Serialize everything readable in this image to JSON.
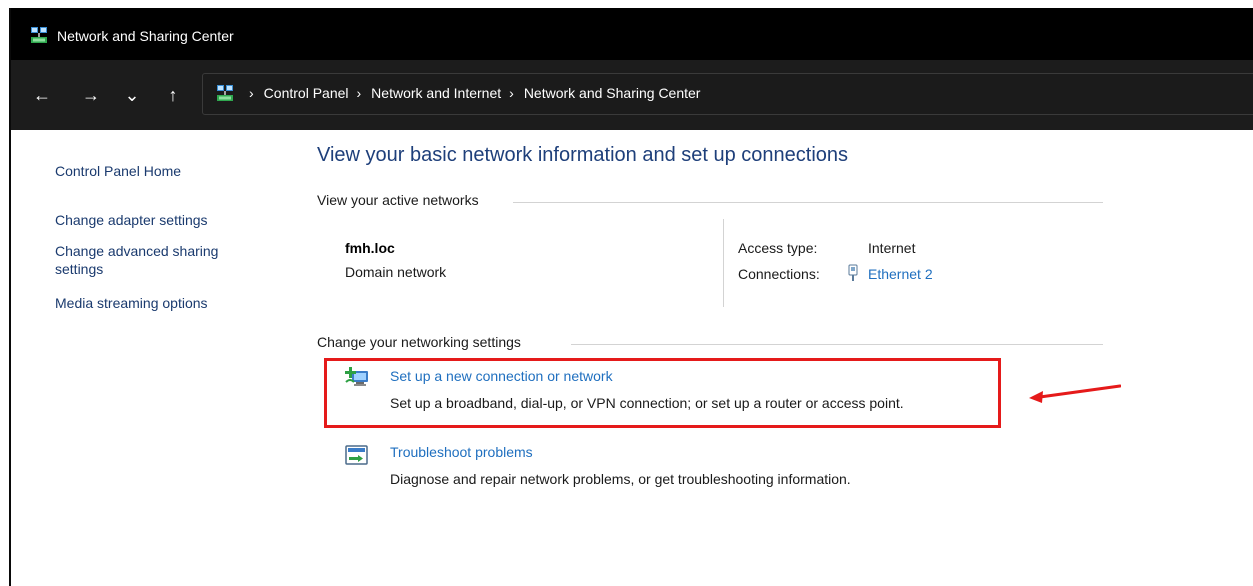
{
  "window": {
    "title": "Network and Sharing Center",
    "app_icon": "network-center-icon"
  },
  "nav": {
    "back_icon": "←",
    "forward_icon": "→",
    "recent_icon": "⌄",
    "up_icon": "↑"
  },
  "breadcrumb": {
    "separator": "›",
    "items": [
      "Control Panel",
      "Network and Internet",
      "Network and Sharing Center"
    ]
  },
  "sidebar": {
    "items": [
      {
        "label": "Control Panel Home"
      },
      {
        "label": "Change adapter settings"
      },
      {
        "label": "Change advanced sharing settings"
      },
      {
        "label": "Media streaming options"
      }
    ]
  },
  "main": {
    "heading": "View your basic network information and set up connections",
    "active_networks_label": "View your active networks",
    "network": {
      "name": "fmh.loc",
      "type": "Domain network",
      "access_type_label": "Access type:",
      "access_type_value": "Internet",
      "connections_label": "Connections:",
      "connections_value": "Ethernet 2"
    },
    "change_settings_label": "Change your networking settings",
    "tasks": [
      {
        "title": "Set up a new connection or network",
        "description": "Set up a broadband, dial-up, or VPN connection; or set up a router or access point.",
        "icon": "new-connection-icon"
      },
      {
        "title": "Troubleshoot problems",
        "description": "Diagnose and repair network problems, or get troubleshooting information.",
        "icon": "troubleshoot-icon"
      }
    ]
  },
  "annotation": {
    "highlight_color": "#e51a1a",
    "arrow_color": "#e51a1a"
  },
  "colors": {
    "titlebar_bg": "#000000",
    "navbar_bg": "#1c1c1c",
    "link": "#1f6fbf",
    "heading": "#1e3f7a",
    "sidebar_link": "#1a3a6e"
  }
}
